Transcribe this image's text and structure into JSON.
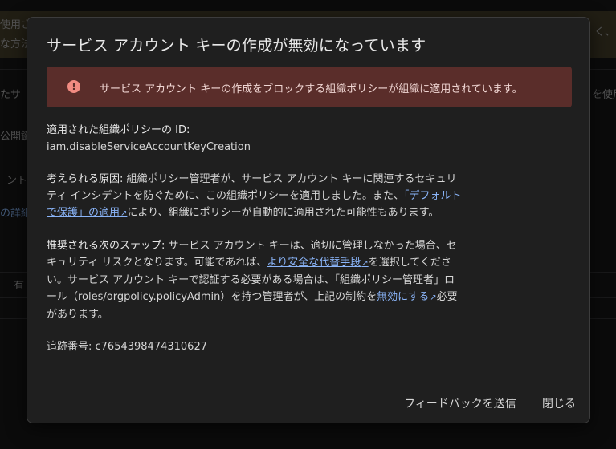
{
  "dialog": {
    "title": "サービス アカウント キーの作成が無効になっています",
    "alert_text": "サービス アカウント キーの作成をブロックする組織ポリシーが組織に適用されています。",
    "policy_id_label": "適用された組織ポリシーの ID:",
    "policy_id_value": "iam.disableServiceAccountKeyCreation",
    "cause_label": "考えられる原因:",
    "cause_text_1": " 組織ポリシー管理者が、サービス アカウント キーに関連するセキュリティ インシデントを防ぐために、この組織ポリシーを適用しました。また、",
    "cause_link": "「デフォルトで保護」の適用",
    "cause_text_2": "により、組織にポリシーが自動的に適用された可能性もあります。",
    "steps_label": "推奨される次のステップ:",
    "steps_text_1": " サービス アカウント キーは、適切に管理しなかった場合、セキュリティ リスクとなります。可能であれば、",
    "steps_link_1": "より安全な代替手段",
    "steps_text_2": "を選択してください。サービス アカウント キーで認証する必要がある場合は、「組織ポリシー管理者」ロール（roles/orgpolicy.policyAdmin）を持つ管理者が、上記の制約を",
    "steps_link_2": "無効にする",
    "steps_text_3": "必要があります。",
    "tracking_label": "追跡番号: c7654398474310627",
    "feedback_button": "フィードバックを送信",
    "close_button": "閉じる"
  },
  "background": {
    "banner_left_1": "使用さ",
    "banner_left_2": "な方法",
    "banner_right": "く、",
    "left_1": "たサ",
    "right_1": "を使用",
    "left_2": "公開鍵",
    "left_3": "ント",
    "left_4": "の詳細",
    "left_5": "有"
  },
  "colors": {
    "alert_bg": "#5a2d2a",
    "alert_icon": "#f28b82",
    "link": "#8ab4f8"
  }
}
